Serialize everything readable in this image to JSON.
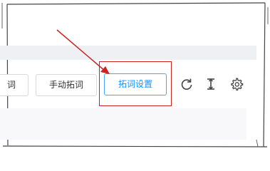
{
  "toolbar": {
    "partial_button_label": "词",
    "manual_button_label": "手动拓词",
    "settings_button_label": "拓词设置"
  },
  "icons": {
    "refresh": "refresh-icon",
    "height": "text-height-icon",
    "gear": "gear-icon"
  },
  "annotation": {
    "highlight_color": "#cc2222",
    "arrow_color": "#cc2222"
  },
  "colors": {
    "accent": "#1890ff",
    "band": "#eef0f4"
  }
}
